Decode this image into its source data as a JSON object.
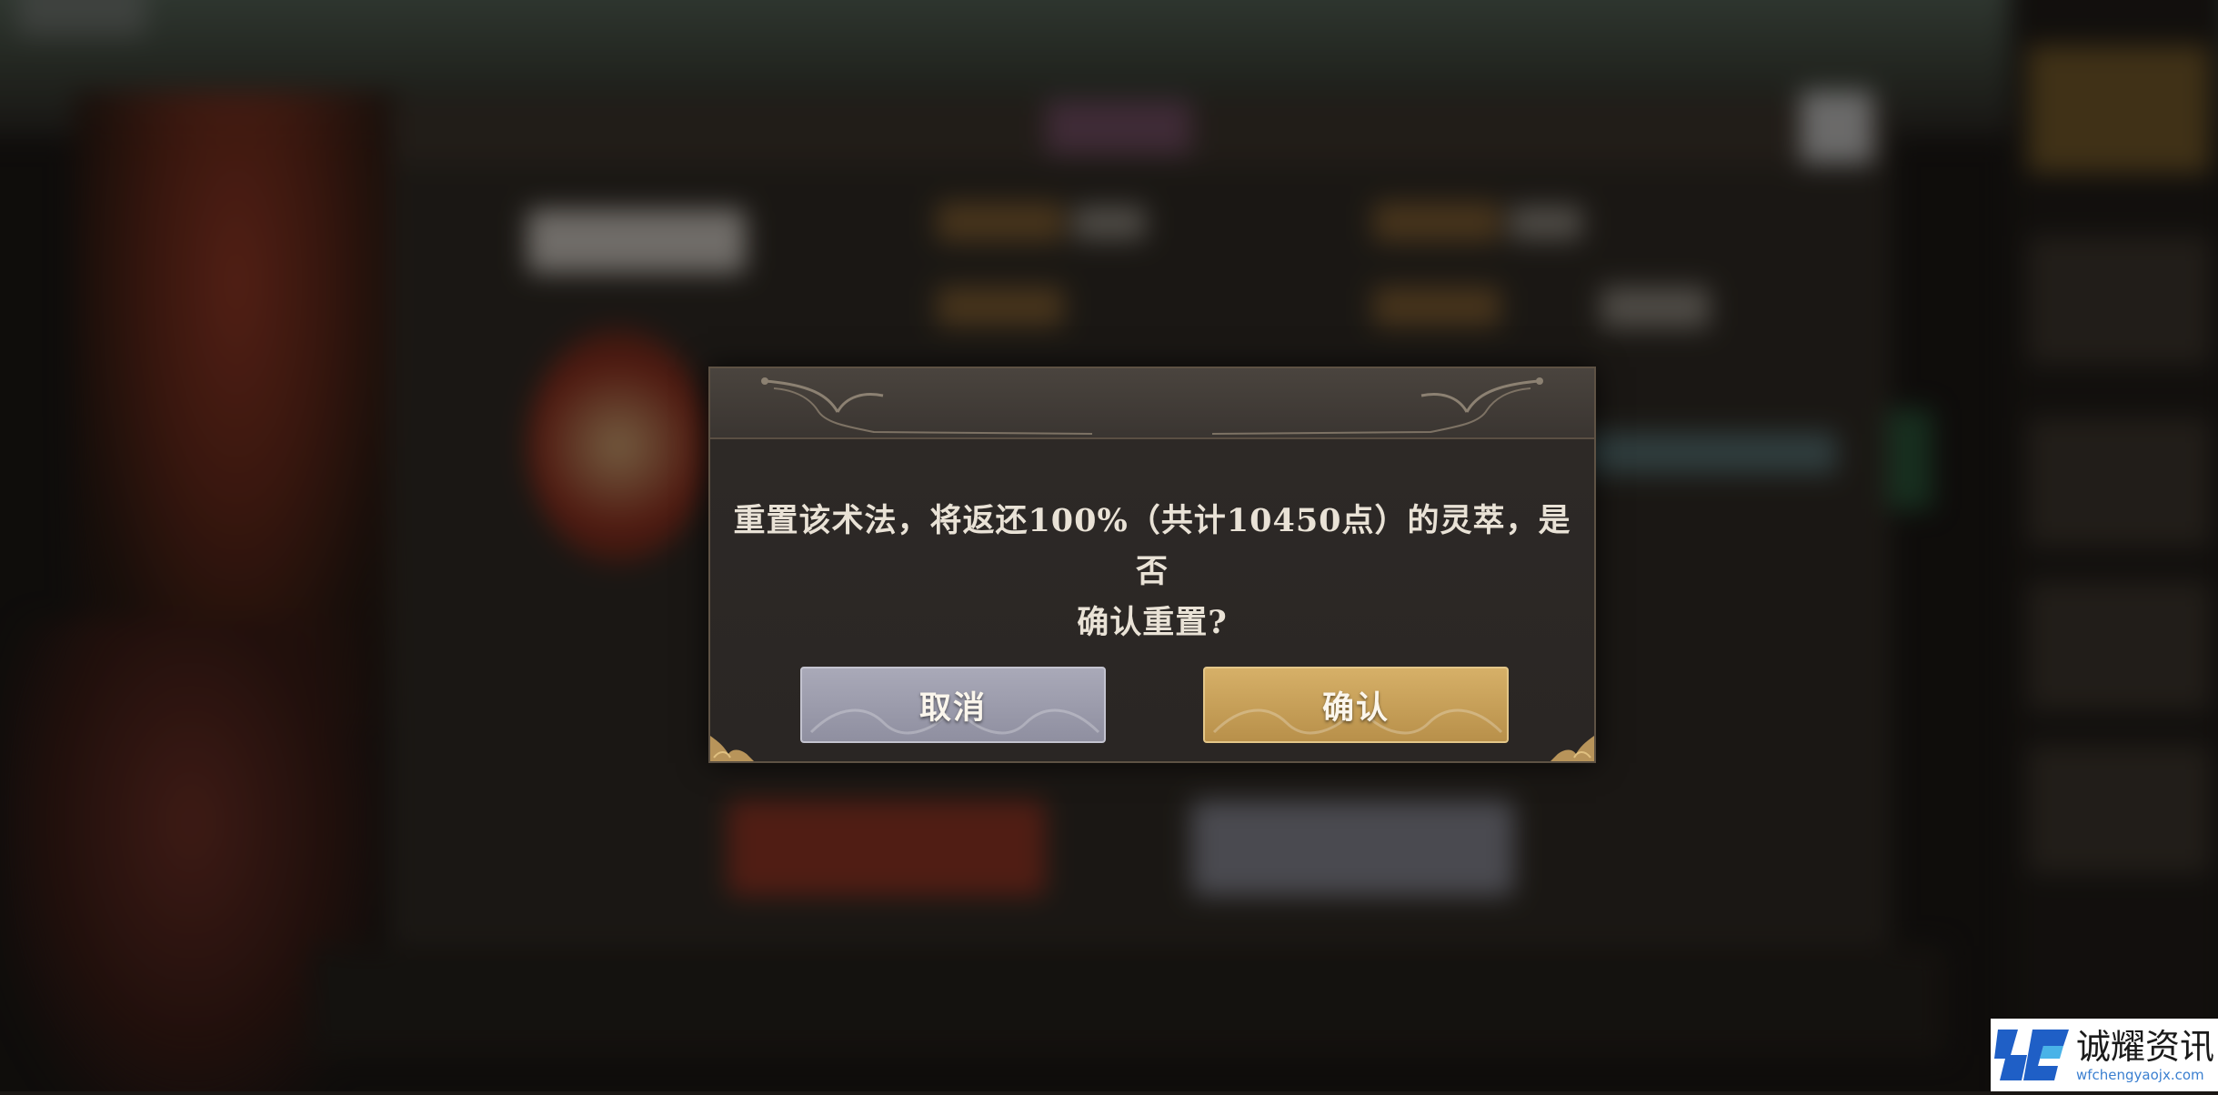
{
  "dialog": {
    "message_line1": "重置该术法，将返还100%（共计10450点）的灵萃，是否",
    "message_line2": "确认重置?",
    "cancel_label": "取消",
    "confirm_label": "确认"
  },
  "watermark": {
    "title": "诚耀资讯",
    "subtitle": "wfchengyaojx.com"
  },
  "colors": {
    "cancel_button": "#9a9aab",
    "confirm_button": "#c9a25a",
    "dialog_bg": "#2c2826",
    "dialog_border": "#5e5244"
  }
}
